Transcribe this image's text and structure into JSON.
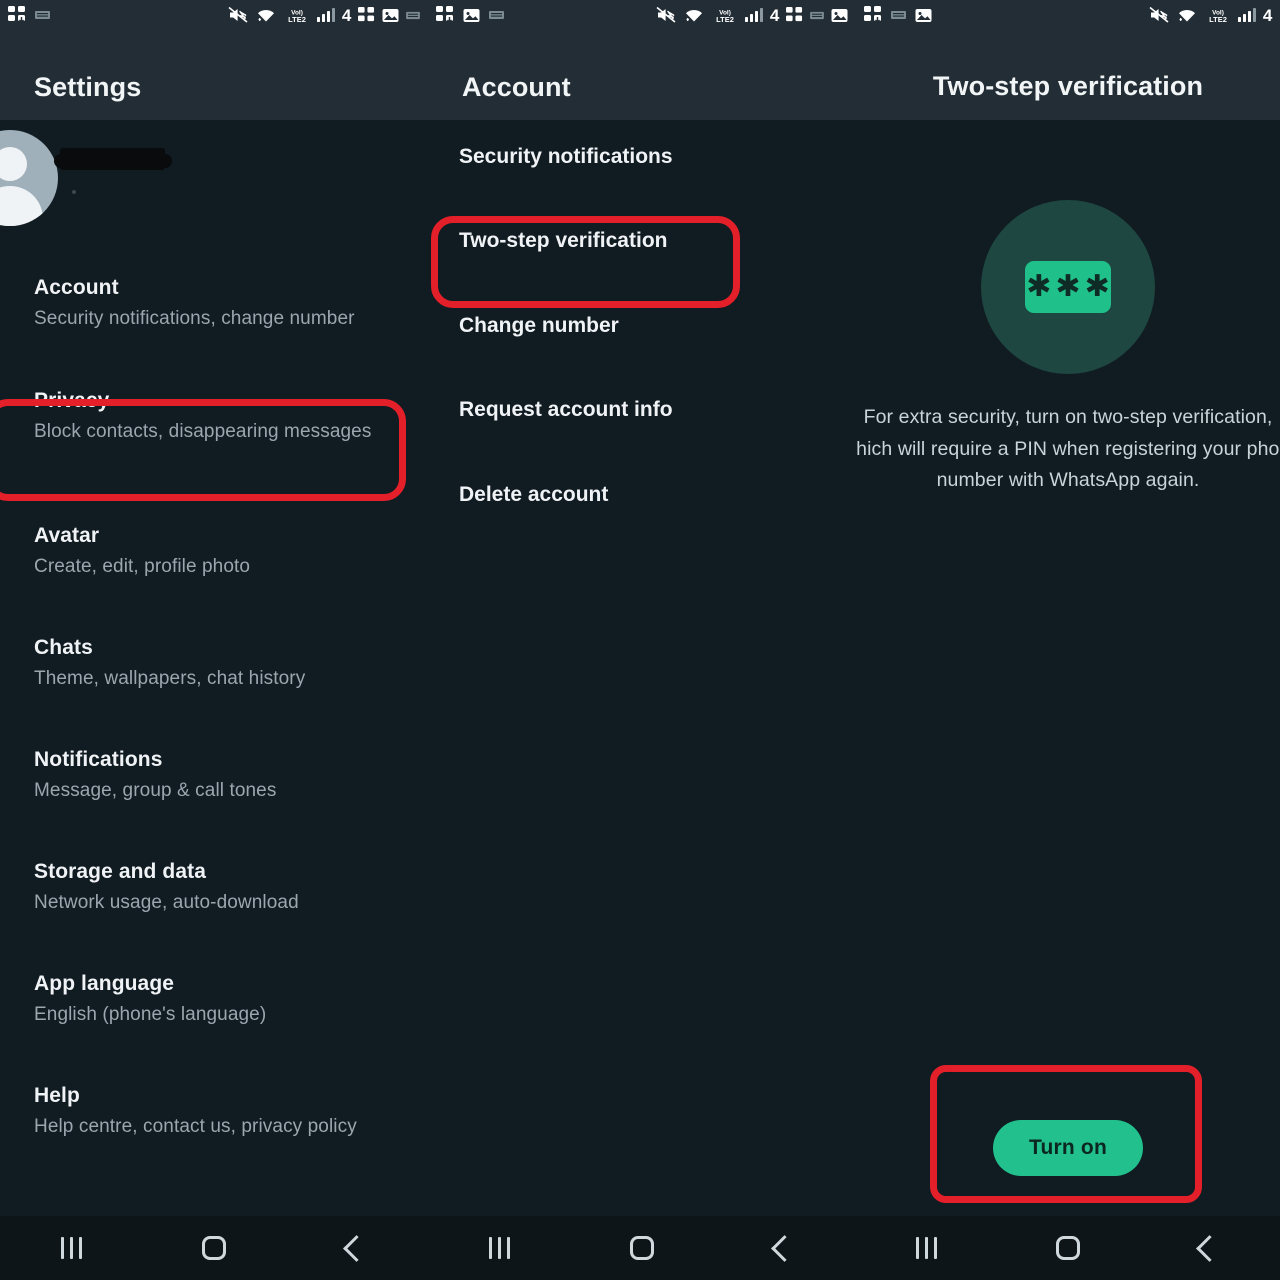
{
  "status_bar": {
    "icons_left_panel1": [
      "apps-icon",
      "sim-card-icon"
    ],
    "icons_left_panel2": [
      "apps-icon",
      "image-icon",
      "sim-card-icon"
    ],
    "icons_left_panel3": [
      "apps-icon",
      "sim-card-icon",
      "image-icon"
    ],
    "icons_right": [
      "mute-icon",
      "wifi-icon",
      "volte2-icon",
      "signal-icon"
    ],
    "network_label": "VoLTE2",
    "battery_or_count": "4"
  },
  "panel_settings": {
    "header_title": "Settings",
    "profile": {
      "name_redacted": "",
      "status_redacted": ""
    },
    "items": [
      {
        "title": "Account",
        "subtitle": "Security notifications, change number"
      },
      {
        "title": "Privacy",
        "subtitle": "Block contacts, disappearing messages"
      },
      {
        "title": "Avatar",
        "subtitle": "Create, edit, profile photo"
      },
      {
        "title": "Chats",
        "subtitle": "Theme, wallpapers, chat history"
      },
      {
        "title": "Notifications",
        "subtitle": "Message, group & call tones"
      },
      {
        "title": "Storage and data",
        "subtitle": "Network usage, auto-download"
      },
      {
        "title": "App language",
        "subtitle": "English (phone's language)"
      },
      {
        "title": "Help",
        "subtitle": "Help centre, contact us, privacy policy"
      }
    ]
  },
  "panel_account": {
    "header_title": "Account",
    "items": [
      {
        "title": "Security notifications"
      },
      {
        "title": "Two-step verification"
      },
      {
        "title": "Change number"
      },
      {
        "title": "Request account info"
      },
      {
        "title": "Delete account"
      }
    ]
  },
  "panel_twostep": {
    "header_title": "Two-step verification",
    "pin_icon_asterisks": "∗∗∗",
    "description_lines": [
      "For extra security, turn on two-step verification,",
      "which will require a PIN when registering your phone",
      "number with WhatsApp again."
    ],
    "turn_on_label": "Turn on"
  },
  "highlights": {
    "color": "#e3202a",
    "targets": [
      "Account",
      "Two-step verification",
      "Turn on"
    ]
  },
  "nav_bar": {
    "buttons": [
      "recents",
      "home",
      "back"
    ]
  },
  "colors": {
    "header_bg": "#222d35",
    "body_bg": "#111b22",
    "nav_bg": "#0d1519",
    "accent_green": "#21c08c",
    "icon_circle_teal": "#1d4740",
    "text_primary": "#f0f3f5",
    "text_secondary": "#9aa7ae",
    "highlight_red": "#e3202a"
  }
}
